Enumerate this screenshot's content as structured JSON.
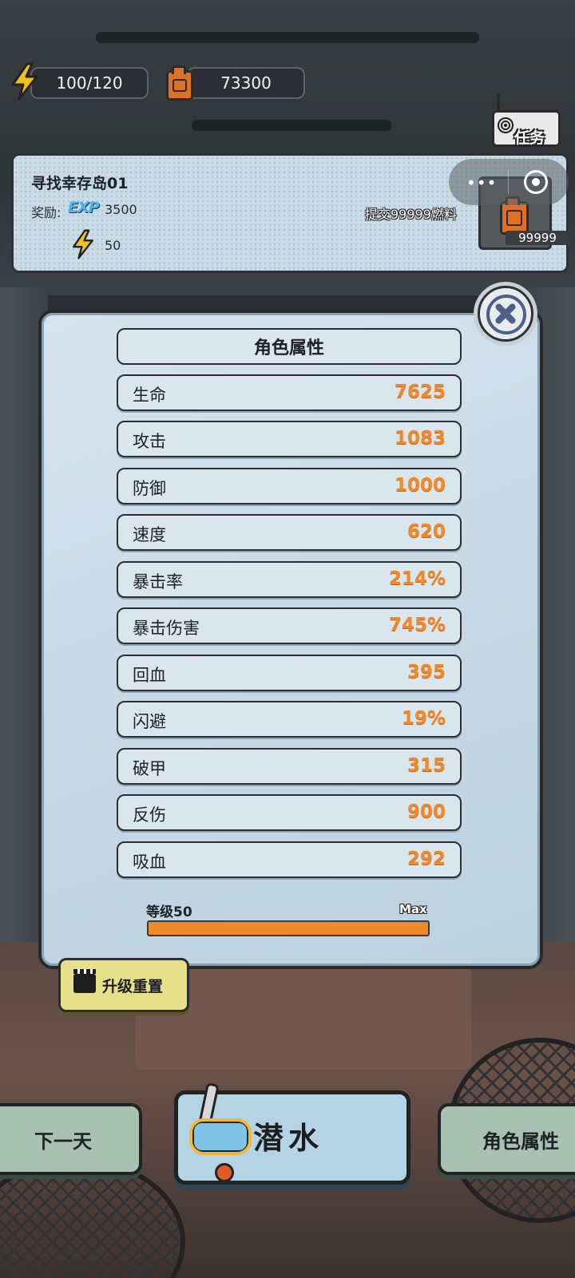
{
  "hud": {
    "energy": "100/120",
    "fuel": "73300"
  },
  "quest": {
    "title": "寻找幸存岛01",
    "reward_label": "奖励:",
    "exp_badge": "EXP",
    "exp_value": "3500",
    "energy_value": "50",
    "submit_text": "提交99999燃料",
    "fuel_required": "99999",
    "task_label": "任务"
  },
  "panel": {
    "title": "角色属性",
    "stats": [
      {
        "name": "生命",
        "value": "7625"
      },
      {
        "name": "攻击",
        "value": "1083"
      },
      {
        "name": "防御",
        "value": "1000"
      },
      {
        "name": "速度",
        "value": "620"
      },
      {
        "name": "暴击率",
        "value": "214%"
      },
      {
        "name": "暴击伤害",
        "value": "745%"
      },
      {
        "name": "回血",
        "value": "395"
      },
      {
        "name": "闪避",
        "value": "19%"
      },
      {
        "name": "破甲",
        "value": "315"
      },
      {
        "name": "反伤",
        "value": "900"
      },
      {
        "name": "吸血",
        "value": "292"
      }
    ],
    "level_label": "等级50",
    "max_label": "Max",
    "level_progress": 1.0,
    "reset_label": "升级重置"
  },
  "bottom": {
    "next_day": "下一天",
    "dive": "潜水",
    "attributes": "角色属性"
  },
  "colors": {
    "stat_value": "#ef8a2c",
    "panel_bg": "#c8d9e6",
    "exp_blue": "#4fb3e6",
    "fuel_orange": "#e07026"
  }
}
